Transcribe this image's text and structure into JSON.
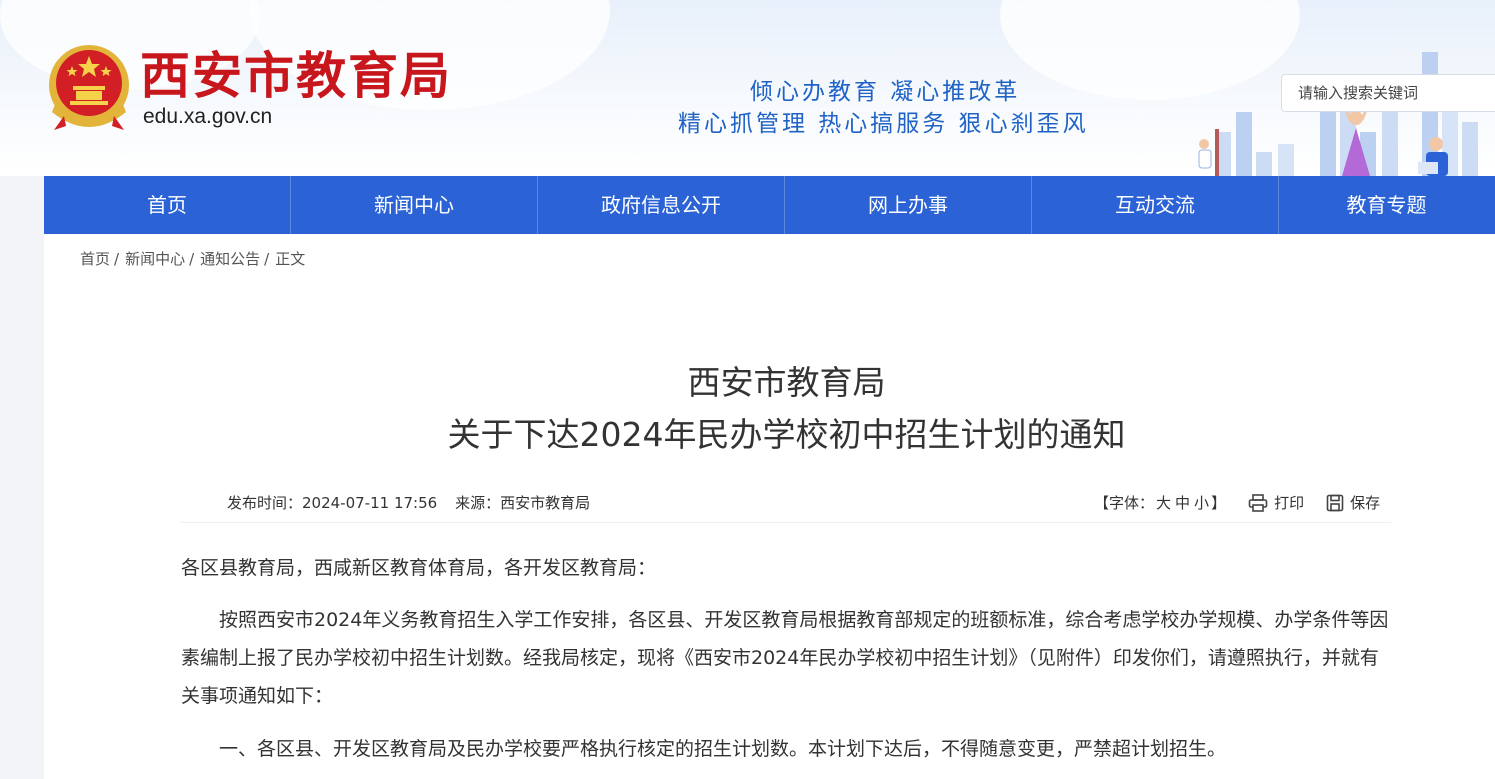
{
  "header": {
    "site_title": "西安市教育局",
    "site_domain": "edu.xa.gov.cn",
    "slogan_line1": "倾心办教育  凝心推改革",
    "slogan_line2": "精心抓管理  热心搞服务  狠心刹歪风",
    "search_placeholder": "请输入搜索关键词"
  },
  "nav": {
    "items": [
      "首页",
      "新闻中心",
      "政府信息公开",
      "网上办事",
      "互动交流",
      "教育专题"
    ]
  },
  "breadcrumb": {
    "items": [
      "首页",
      "新闻中心",
      "通知公告",
      "正文"
    ],
    "separator": "/"
  },
  "article": {
    "title_line1": "西安市教育局",
    "title_line2": "关于下达2024年民办学校初中招生计划的通知",
    "publish_time": "发布时间：2024-07-11 17:56",
    "source": "来源：西安市教育局",
    "font_size_open": "【字体：",
    "font_size_options": [
      "大",
      "中",
      "小"
    ],
    "font_size_close": "】",
    "print_label": "打印",
    "save_label": "保存",
    "paragraphs": [
      "各区县教育局，西咸新区教育体育局，各开发区教育局：",
      "按照西安市2024年义务教育招生入学工作安排，各区县、开发区教育局根据教育部规定的班额标准，综合考虑学校办学规模、办学条件等因素编制上报了民办学校初中招生计划数。经我局核定，现将《西安市2024年民办学校初中招生计划》（见附件）印发你们，请遵照执行，并就有关事项通知如下：",
      "一、各区县、开发区教育局及民办学校要严格执行核定的招生计划数。本计划下达后，不得随意变更，严禁超计划招生。"
    ]
  },
  "colors": {
    "title_red": "#c8161d",
    "nav_blue": "#2b63d6",
    "slogan_blue": "#1f63c6"
  }
}
